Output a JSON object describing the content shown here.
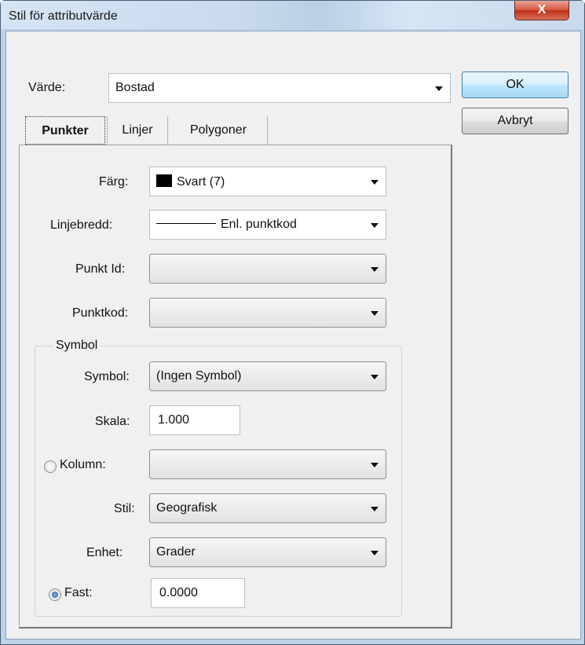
{
  "window": {
    "title": "Stil för attributvärde",
    "close_label": "X"
  },
  "value": {
    "label": "Värde:",
    "selected": "Bostad"
  },
  "buttons": {
    "ok": "OK",
    "cancel": "Avbryt"
  },
  "tabs": [
    "Punkter",
    "Linjer",
    "Polygoner"
  ],
  "points": {
    "color": {
      "label": "Färg:",
      "value": "Svart (7)"
    },
    "line_width": {
      "label": "Linjebredd:",
      "value": "Enl. punktkod"
    },
    "point_id": {
      "label": "Punkt Id:",
      "value": ""
    },
    "point_code": {
      "label": "Punktkod:",
      "value": ""
    }
  },
  "symbol": {
    "group_label": "Symbol",
    "symbol": {
      "label": "Symbol:",
      "value": "(Ingen Symbol)"
    },
    "scale": {
      "label": "Skala:",
      "value": "1.000"
    },
    "column": {
      "label": "Kolumn:",
      "value": "",
      "selected": false
    },
    "style": {
      "label": "Stil:",
      "value": "Geografisk"
    },
    "unit": {
      "label": "Enhet:",
      "value": "Grader"
    },
    "fixed": {
      "label": "Fast:",
      "value": "0.0000",
      "selected": true
    }
  }
}
